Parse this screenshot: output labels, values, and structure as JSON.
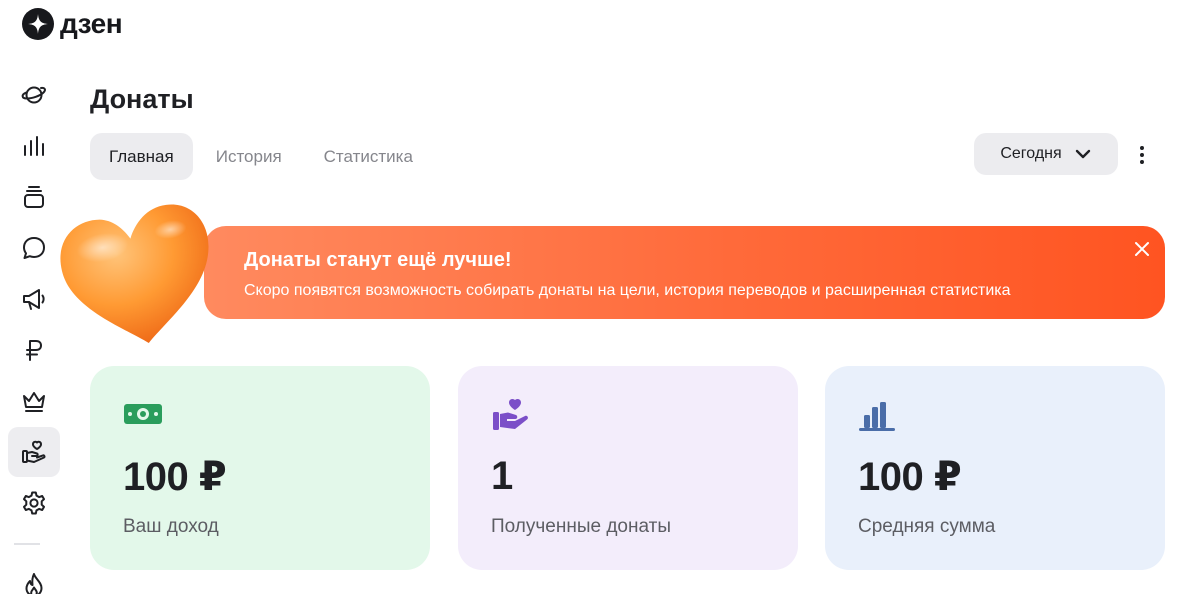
{
  "app": {
    "logo_text": "дзен"
  },
  "sidebar": {
    "items": [
      {
        "icon": "planet-icon",
        "label": ""
      },
      {
        "icon": "stats-bars-icon",
        "label": ""
      },
      {
        "icon": "stack-icon",
        "label": ""
      },
      {
        "icon": "chat-bubble-icon",
        "label": ""
      },
      {
        "icon": "megaphone-icon",
        "label": ""
      },
      {
        "icon": "ruble-icon",
        "label": ""
      },
      {
        "icon": "crown-icon",
        "label": ""
      },
      {
        "icon": "hand-heart-icon",
        "label": "",
        "active": true
      },
      {
        "icon": "gear-icon",
        "label": ""
      },
      {
        "icon": "fire-icon",
        "label": ""
      }
    ]
  },
  "header": {
    "title": "Донаты",
    "tabs": [
      {
        "label": "Главная",
        "active": true
      },
      {
        "label": "История",
        "active": false
      },
      {
        "label": "Статистика",
        "active": false
      }
    ],
    "period": {
      "selected": "Сегодня"
    }
  },
  "banner": {
    "title": "Донаты станут ещё лучше!",
    "text": "Скоро появятся возможность собирать донаты на цели, история переводов и расширенная статистика",
    "accent_color": "#ff5a24"
  },
  "cards": [
    {
      "value": "100 ₽",
      "label": "Ваш доход",
      "icon": "banknote-icon",
      "color": "#e3f8ea"
    },
    {
      "value": "1",
      "label": "Полученные донаты",
      "icon": "hand-heart-icon",
      "color": "#f3edfb"
    },
    {
      "value": "100 ₽",
      "label": "Средняя сумма",
      "icon": "bar-chart-icon",
      "color": "#e9f0fb"
    }
  ]
}
